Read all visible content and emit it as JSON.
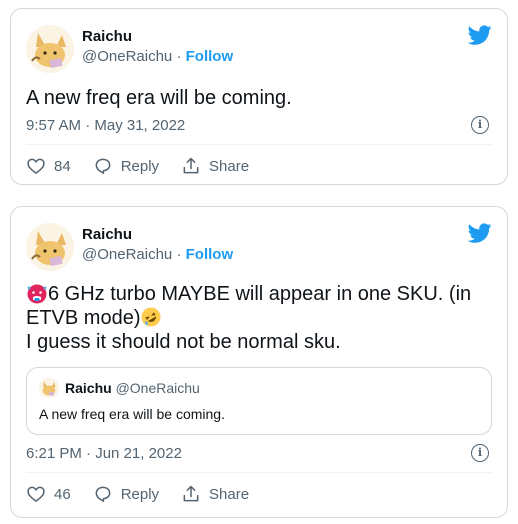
{
  "tweets": [
    {
      "name": "Raichu",
      "handle": "@OneRaichu",
      "separator": "·",
      "follow_label": "Follow",
      "text": "A new freq era will be coming.",
      "time": "9:57 AM · May 31, 2022",
      "likes": "84",
      "reply_label": "Reply",
      "share_label": "Share",
      "info_glyph": "i"
    },
    {
      "name": "Raichu",
      "handle": "@OneRaichu",
      "separator": "·",
      "follow_label": "Follow",
      "text_part1": "6 GHz turbo MAYBE will appear in one SKU. (in ETVB mode)",
      "text_line2": "I guess it should not be normal sku.",
      "quote": {
        "name": "Raichu",
        "handle": "@OneRaichu",
        "text": "A new freq era will be coming."
      },
      "time": "6:21 PM · Jun 21, 2022",
      "likes": "46",
      "reply_label": "Reply",
      "share_label": "Share",
      "info_glyph": "i"
    }
  ],
  "colors": {
    "accent": "#1d9bf0",
    "secondary_text": "#536471",
    "border": "#cfd9de",
    "hot_face": "#e0245e",
    "rofl": "#ffcc4d"
  },
  "icons": [
    "avatar-raichu",
    "twitter-bird-icon",
    "info-icon",
    "heart-icon",
    "reply-icon",
    "share-icon",
    "hot-face-emoji",
    "rofl-emoji"
  ]
}
